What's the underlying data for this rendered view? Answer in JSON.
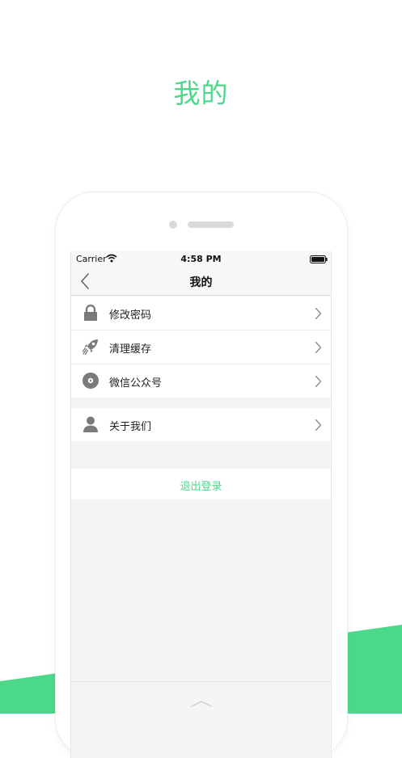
{
  "promo": {
    "title": "我的"
  },
  "status_bar": {
    "carrier": "Carrier",
    "time": "4:58 PM"
  },
  "nav": {
    "title": "我的"
  },
  "menu": {
    "items": [
      {
        "label": "修改密码",
        "icon": "lock-icon"
      },
      {
        "label": "清理缓存",
        "icon": "rocket-icon"
      },
      {
        "label": "微信公众号",
        "icon": "disc-icon"
      },
      {
        "label": "关于我们",
        "icon": "person-icon"
      }
    ]
  },
  "logout": {
    "label": "退出登录"
  },
  "colors": {
    "accent": "#4cd88a",
    "screen_background": "#f5f5f5",
    "icon_gray": "#7a7a7a"
  }
}
